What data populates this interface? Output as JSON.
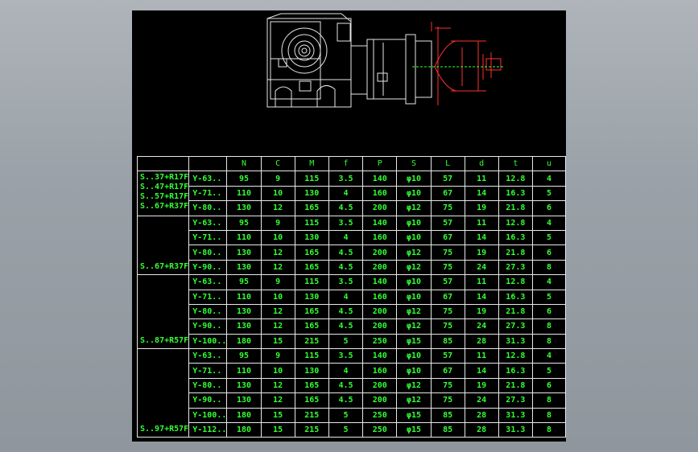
{
  "headers": [
    "",
    "",
    "N",
    "C",
    "M",
    "f",
    "P",
    "S",
    "L",
    "d",
    "t",
    "u"
  ],
  "groups": [
    {
      "labels": [
        "S..37+R17F",
        "S..47+R17F",
        "S..57+R17F",
        "S..67+R37F"
      ],
      "rows": [
        [
          "Y-63..",
          "95",
          "9",
          "115",
          "3.5",
          "140",
          "φ10",
          "57",
          "11",
          "12.8",
          "4"
        ],
        [
          "Y-71..",
          "110",
          "10",
          "130",
          "4",
          "160",
          "φ10",
          "67",
          "14",
          "16.3",
          "5"
        ],
        [
          "Y-80..",
          "130",
          "12",
          "165",
          "4.5",
          "200",
          "φ12",
          "75",
          "19",
          "21.8",
          "6"
        ]
      ]
    },
    {
      "labels": [
        "S..67+R37F"
      ],
      "rows": [
        [
          "Y-63..",
          "95",
          "9",
          "115",
          "3.5",
          "140",
          "φ10",
          "57",
          "11",
          "12.8",
          "4"
        ],
        [
          "Y-71..",
          "110",
          "10",
          "130",
          "4",
          "160",
          "φ10",
          "67",
          "14",
          "16.3",
          "5"
        ],
        [
          "Y-80..",
          "130",
          "12",
          "165",
          "4.5",
          "200",
          "φ12",
          "75",
          "19",
          "21.8",
          "6"
        ],
        [
          "Y-90..",
          "130",
          "12",
          "165",
          "4.5",
          "200",
          "φ12",
          "75",
          "24",
          "27.3",
          "8"
        ]
      ]
    },
    {
      "labels": [
        "S..87+R57F"
      ],
      "rows": [
        [
          "Y-63..",
          "95",
          "9",
          "115",
          "3.5",
          "140",
          "φ10",
          "57",
          "11",
          "12.8",
          "4"
        ],
        [
          "Y-71..",
          "110",
          "10",
          "130",
          "4",
          "160",
          "φ10",
          "67",
          "14",
          "16.3",
          "5"
        ],
        [
          "Y-80..",
          "130",
          "12",
          "165",
          "4.5",
          "200",
          "φ12",
          "75",
          "19",
          "21.8",
          "6"
        ],
        [
          "Y-90..",
          "130",
          "12",
          "165",
          "4.5",
          "200",
          "φ12",
          "75",
          "24",
          "27.3",
          "8"
        ],
        [
          "Y-100..",
          "180",
          "15",
          "215",
          "5",
          "250",
          "φ15",
          "85",
          "28",
          "31.3",
          "8"
        ]
      ]
    },
    {
      "labels": [
        "S..97+R57F"
      ],
      "rows": [
        [
          "Y-63..",
          "95",
          "9",
          "115",
          "3.5",
          "140",
          "φ10",
          "57",
          "11",
          "12.8",
          "4"
        ],
        [
          "Y-71..",
          "110",
          "10",
          "130",
          "4",
          "160",
          "φ10",
          "67",
          "14",
          "16.3",
          "5"
        ],
        [
          "Y-80..",
          "130",
          "12",
          "165",
          "4.5",
          "200",
          "φ12",
          "75",
          "19",
          "21.8",
          "6"
        ],
        [
          "Y-90..",
          "130",
          "12",
          "165",
          "4.5",
          "200",
          "φ12",
          "75",
          "24",
          "27.3",
          "8"
        ],
        [
          "Y-100..",
          "180",
          "15",
          "215",
          "5",
          "250",
          "φ15",
          "85",
          "28",
          "31.3",
          "8"
        ],
        [
          "Y-112..",
          "180",
          "15",
          "215",
          "5",
          "250",
          "φ15",
          "85",
          "28",
          "31.3",
          "8"
        ]
      ]
    }
  ],
  "colors": {
    "table_text": "#33ff33",
    "grid_line": "#e8e8e8",
    "sheet": "#000000",
    "dimension": "#ff3030"
  }
}
